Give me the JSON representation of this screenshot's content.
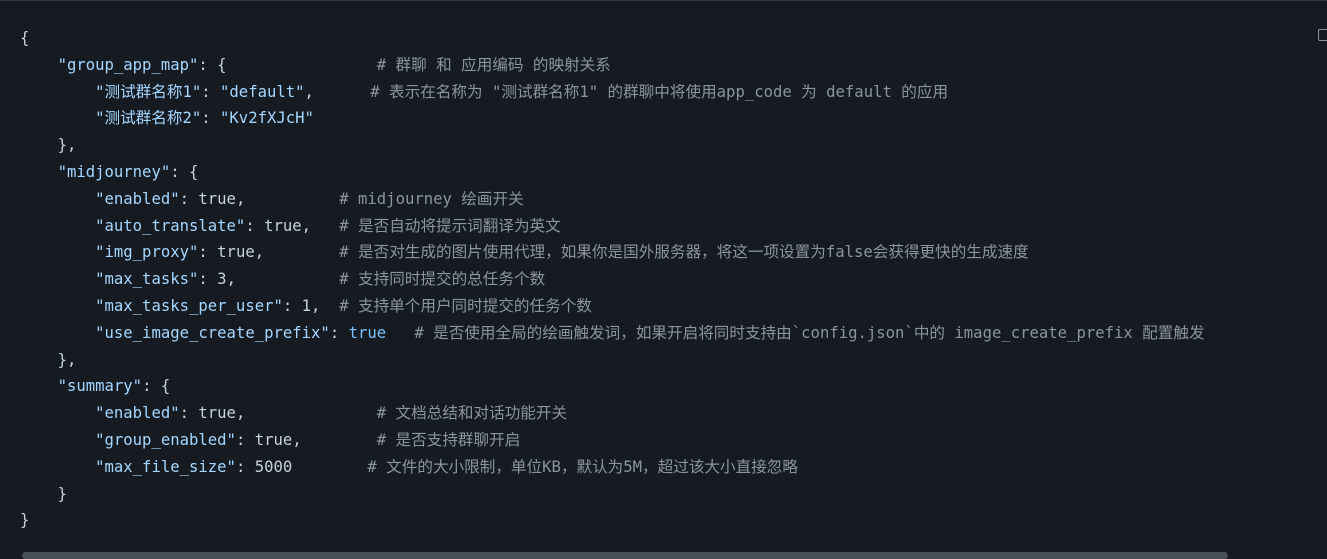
{
  "code": {
    "language": "json",
    "lines": [
      [
        {
          "t": "punc",
          "v": "{"
        }
      ],
      [
        {
          "t": "key",
          "v": "\"group_app_map\""
        },
        {
          "t": "punc",
          "v": ": {"
        },
        {
          "t": "plain",
          "v": "                "
        },
        {
          "t": "comment",
          "v": "# 群聊 和 应用编码 的映射关系"
        }
      ],
      [
        {
          "t": "key",
          "v": "\"测试群名称1\""
        },
        {
          "t": "punc",
          "v": ": "
        },
        {
          "t": "str",
          "v": "\"default\""
        },
        {
          "t": "punc",
          "v": ","
        },
        {
          "t": "plain",
          "v": "      "
        },
        {
          "t": "comment",
          "v": "# 表示在名称为 \"测试群名称1\" 的群聊中将使用app_code 为 default 的应用"
        }
      ],
      [
        {
          "t": "key",
          "v": "\"测试群名称2\""
        },
        {
          "t": "punc",
          "v": ": "
        },
        {
          "t": "str",
          "v": "\"Kv2fXJcH\""
        }
      ],
      [
        {
          "t": "punc",
          "v": "},"
        }
      ],
      [
        {
          "t": "key",
          "v": "\"midjourney\""
        },
        {
          "t": "punc",
          "v": ": {"
        }
      ],
      [
        {
          "t": "key",
          "v": "\"enabled\""
        },
        {
          "t": "punc",
          "v": ": "
        },
        {
          "t": "plain",
          "v": "true"
        },
        {
          "t": "punc",
          "v": ","
        },
        {
          "t": "plain",
          "v": "          "
        },
        {
          "t": "comment",
          "v": "# midjourney 绘画开关"
        }
      ],
      [
        {
          "t": "key",
          "v": "\"auto_translate\""
        },
        {
          "t": "punc",
          "v": ": "
        },
        {
          "t": "plain",
          "v": "true"
        },
        {
          "t": "punc",
          "v": ","
        },
        {
          "t": "plain",
          "v": "   "
        },
        {
          "t": "comment",
          "v": "# 是否自动将提示词翻译为英文"
        }
      ],
      [
        {
          "t": "key",
          "v": "\"img_proxy\""
        },
        {
          "t": "punc",
          "v": ": "
        },
        {
          "t": "plain",
          "v": "true"
        },
        {
          "t": "punc",
          "v": ","
        },
        {
          "t": "plain",
          "v": "        "
        },
        {
          "t": "comment",
          "v": "# 是否对生成的图片使用代理，如果你是国外服务器，将这一项设置为false会获得更快的生成速度"
        }
      ],
      [
        {
          "t": "key",
          "v": "\"max_tasks\""
        },
        {
          "t": "punc",
          "v": ": "
        },
        {
          "t": "plain",
          "v": "3"
        },
        {
          "t": "punc",
          "v": ","
        },
        {
          "t": "plain",
          "v": "           "
        },
        {
          "t": "comment",
          "v": "# 支持同时提交的总任务个数"
        }
      ],
      [
        {
          "t": "key",
          "v": "\"max_tasks_per_user\""
        },
        {
          "t": "punc",
          "v": ": "
        },
        {
          "t": "plain",
          "v": "1"
        },
        {
          "t": "punc",
          "v": ","
        },
        {
          "t": "plain",
          "v": "  "
        },
        {
          "t": "comment",
          "v": "# 支持单个用户同时提交的任务个数"
        }
      ],
      [
        {
          "t": "key",
          "v": "\"use_image_create_prefix\""
        },
        {
          "t": "punc",
          "v": ": "
        },
        {
          "t": "kw",
          "v": "true"
        },
        {
          "t": "plain",
          "v": "   "
        },
        {
          "t": "comment",
          "v": "# 是否使用全局的绘画触发词，如果开启将同时支持由`config.json`中的 image_create_prefix 配置触发"
        }
      ],
      [
        {
          "t": "punc",
          "v": "},"
        }
      ],
      [
        {
          "t": "key",
          "v": "\"summary\""
        },
        {
          "t": "punc",
          "v": ": {"
        }
      ],
      [
        {
          "t": "key",
          "v": "\"enabled\""
        },
        {
          "t": "punc",
          "v": ": "
        },
        {
          "t": "plain",
          "v": "true"
        },
        {
          "t": "punc",
          "v": ","
        },
        {
          "t": "plain",
          "v": "              "
        },
        {
          "t": "comment",
          "v": "# 文档总结和对话功能开关"
        }
      ],
      [
        {
          "t": "key",
          "v": "\"group_enabled\""
        },
        {
          "t": "punc",
          "v": ": "
        },
        {
          "t": "plain",
          "v": "true"
        },
        {
          "t": "punc",
          "v": ","
        },
        {
          "t": "plain",
          "v": "        "
        },
        {
          "t": "comment",
          "v": "# 是否支持群聊开启"
        }
      ],
      [
        {
          "t": "key",
          "v": "\"max_file_size\""
        },
        {
          "t": "punc",
          "v": ": "
        },
        {
          "t": "plain",
          "v": "5000"
        },
        {
          "t": "plain",
          "v": "        "
        },
        {
          "t": "comment",
          "v": "# 文件的大小限制，单位KB，默认为5M，超过该大小直接忽略"
        }
      ],
      [
        {
          "t": "punc",
          "v": "}"
        }
      ],
      [
        {
          "t": "punc",
          "v": "}"
        }
      ]
    ]
  },
  "icons": {
    "copy": "copy-icon"
  },
  "colors": {
    "background": "#161b22",
    "string": "#a5d6ff",
    "keyword": "#79c0ff",
    "comment": "#8b949e",
    "text": "#c9d1d9"
  }
}
